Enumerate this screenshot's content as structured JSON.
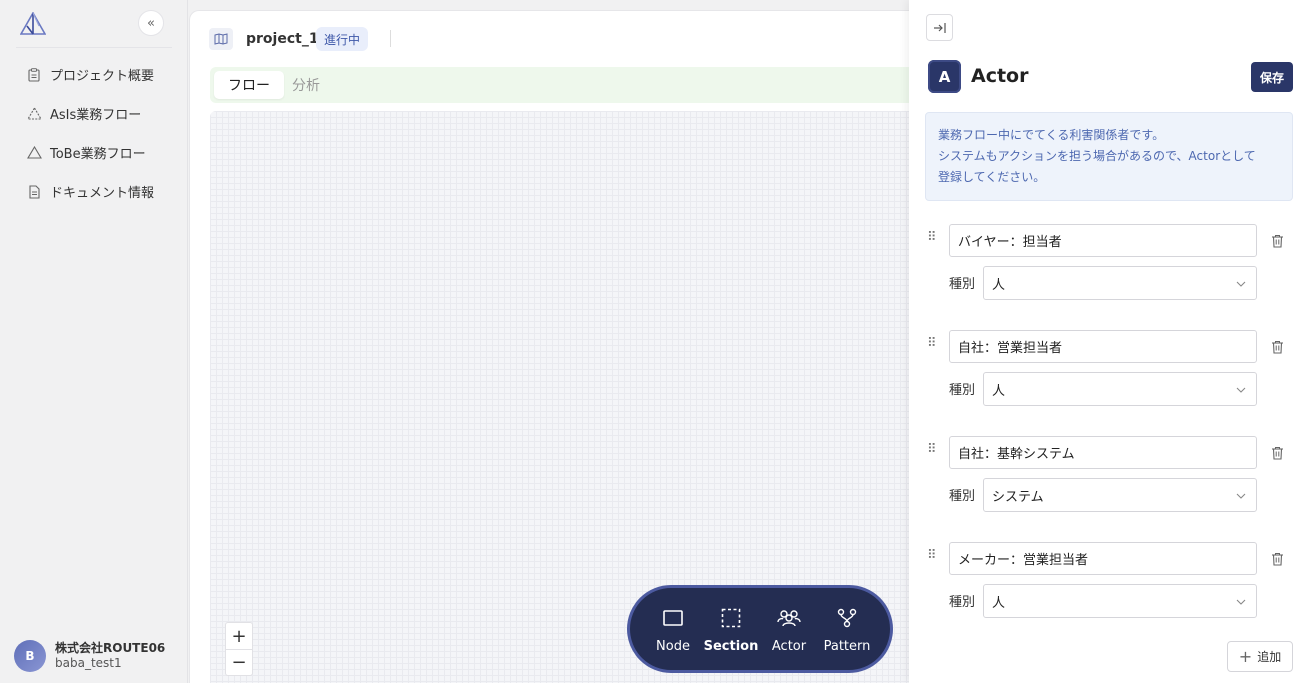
{
  "sidebar": {
    "items": [
      {
        "label": "プロジェクト概要",
        "icon": "clipboard-icon"
      },
      {
        "label": "AsIs業務フロー",
        "icon": "triangle-icon"
      },
      {
        "label": "ToBe業務フロー",
        "icon": "triangle-icon"
      },
      {
        "label": "ドキュメント情報",
        "icon": "document-icon"
      }
    ],
    "collapse_icon": "«",
    "user": {
      "initial": "B",
      "company": "株式会社ROUTE06",
      "name": "baba_test1"
    }
  },
  "header": {
    "project_name": "project_1",
    "status": "進行中"
  },
  "tabs": [
    {
      "label": "フロー",
      "active": true
    },
    {
      "label": "分析",
      "active": false
    }
  ],
  "canvas": {
    "zoom_in": "+",
    "zoom_out": "−"
  },
  "toolbar": {
    "items": [
      {
        "label": "Node",
        "icon": "rectangle-icon"
      },
      {
        "label": "Section",
        "icon": "dashed-square-icon"
      },
      {
        "label": "Actor",
        "icon": "people-icon"
      },
      {
        "label": "Pattern",
        "icon": "branch-icon"
      }
    ]
  },
  "panel": {
    "icon_letter": "A",
    "title": "Actor",
    "save_label": "保存",
    "info_lines": [
      "業務フロー中にでてくる利害関係者です。",
      "システムもアクションを担う場合があるので、Actorとして",
      "登録してください。"
    ],
    "type_label": "種別",
    "actors": [
      {
        "name": "バイヤー：担当者",
        "type": "人"
      },
      {
        "name": "自社：営業担当者",
        "type": "人"
      },
      {
        "name": "自社：基幹システム",
        "type": "システム"
      },
      {
        "name": "メーカー：営業担当者",
        "type": "人"
      }
    ],
    "add_label": "追加"
  },
  "colors": {
    "navy": "#2a3668",
    "toolbar_bg": "#242d52",
    "status_badge_text": "#3d57a8",
    "info_text": "#4d68b0",
    "tab_bg": "#eef8ec"
  }
}
